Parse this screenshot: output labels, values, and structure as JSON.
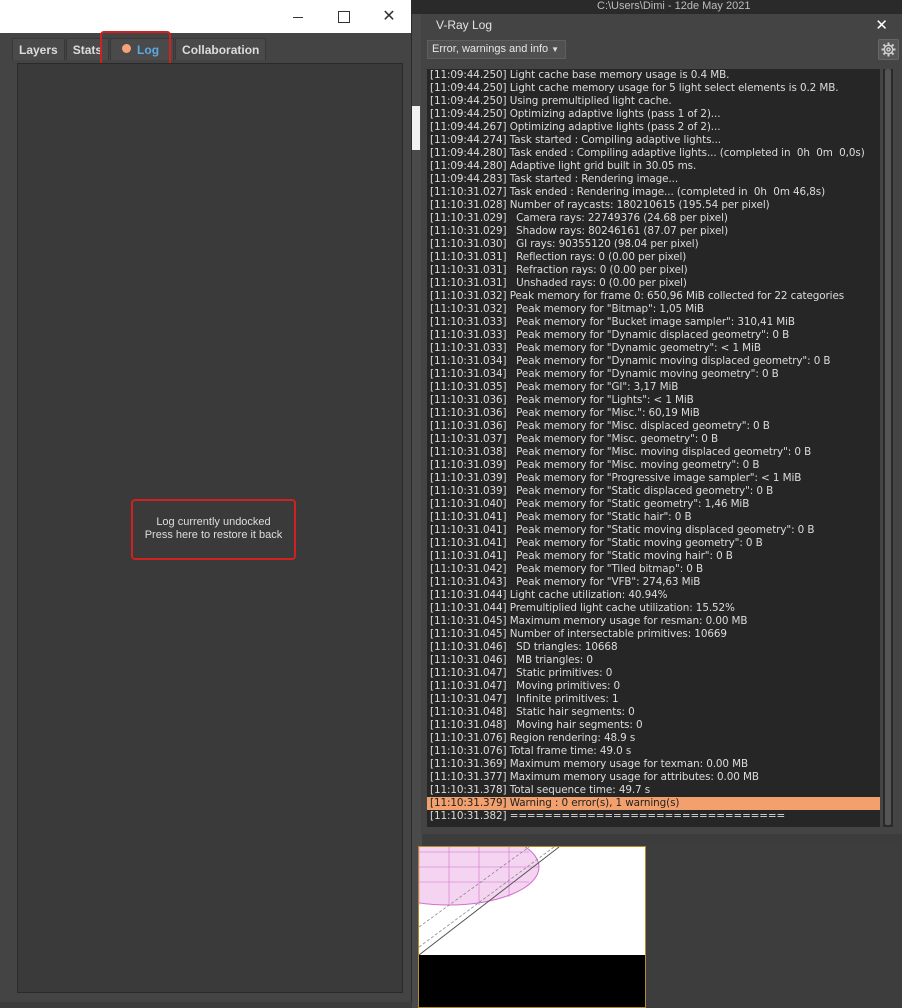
{
  "background": {
    "top_strip_text": "C:\\Users\\Dimi - 12de May 2021"
  },
  "left_window": {
    "window_controls": {
      "minimize": "",
      "maximize": "",
      "close": "✕"
    },
    "tabs": [
      {
        "label": "Layers",
        "active": false
      },
      {
        "label": "Stats",
        "active": false
      },
      {
        "label": "Log",
        "active": true
      },
      {
        "label": "Collaboration",
        "active": false
      }
    ],
    "undocked_message": {
      "line1": "Log currently undocked",
      "line2": "Press here to restore it back"
    }
  },
  "vray_log": {
    "title": "V-Ray Log",
    "close": "✕",
    "filter": {
      "selected": "Error, warnings and info"
    },
    "lines": [
      "[11:09:44.250] Light cache base memory usage is 0.4 MB.",
      "[11:09:44.250] Light cache memory usage for 5 light select elements is 0.2 MB.",
      "[11:09:44.250] Using premultiplied light cache.",
      "[11:09:44.250] Optimizing adaptive lights (pass 1 of 2)...",
      "[11:09:44.267] Optimizing adaptive lights (pass 2 of 2)...",
      "[11:09:44.274] Task started : Compiling adaptive lights...",
      "[11:09:44.280] Task ended : Compiling adaptive lights... (completed in  0h  0m  0,0s)",
      "[11:09:44.280] Adaptive light grid built in 30.05 ms.",
      "[11:09:44.283] Task started : Rendering image...",
      "[11:10:31.027] Task ended : Rendering image... (completed in  0h  0m 46,8s)",
      "[11:10:31.028] Number of raycasts: 180210615 (195.54 per pixel)",
      "[11:10:31.029]   Camera rays: 22749376 (24.68 per pixel)",
      "[11:10:31.029]   Shadow rays: 80246161 (87.07 per pixel)",
      "[11:10:31.030]   GI rays: 90355120 (98.04 per pixel)",
      "[11:10:31.031]   Reflection rays: 0 (0.00 per pixel)",
      "[11:10:31.031]   Refraction rays: 0 (0.00 per pixel)",
      "[11:10:31.031]   Unshaded rays: 0 (0.00 per pixel)",
      "[11:10:31.032] Peak memory for frame 0: 650,96 MiB collected for 22 categories",
      "[11:10:31.032]   Peak memory for \"Bitmap\": 1,05 MiB",
      "[11:10:31.033]   Peak memory for \"Bucket image sampler\": 310,41 MiB",
      "[11:10:31.033]   Peak memory for \"Dynamic displaced geometry\": 0 B",
      "[11:10:31.033]   Peak memory for \"Dynamic geometry\": < 1 MiB",
      "[11:10:31.034]   Peak memory for \"Dynamic moving displaced geometry\": 0 B",
      "[11:10:31.034]   Peak memory for \"Dynamic moving geometry\": 0 B",
      "[11:10:31.035]   Peak memory for \"GI\": 3,17 MiB",
      "[11:10:31.036]   Peak memory for \"Lights\": < 1 MiB",
      "[11:10:31.036]   Peak memory for \"Misc.\": 60,19 MiB",
      "[11:10:31.036]   Peak memory for \"Misc. displaced geometry\": 0 B",
      "[11:10:31.037]   Peak memory for \"Misc. geometry\": 0 B",
      "[11:10:31.038]   Peak memory for \"Misc. moving displaced geometry\": 0 B",
      "[11:10:31.039]   Peak memory for \"Misc. moving geometry\": 0 B",
      "[11:10:31.039]   Peak memory for \"Progressive image sampler\": < 1 MiB",
      "[11:10:31.039]   Peak memory for \"Static displaced geometry\": 0 B",
      "[11:10:31.040]   Peak memory for \"Static geometry\": 1,46 MiB",
      "[11:10:31.041]   Peak memory for \"Static hair\": 0 B",
      "[11:10:31.041]   Peak memory for \"Static moving displaced geometry\": 0 B",
      "[11:10:31.041]   Peak memory for \"Static moving geometry\": 0 B",
      "[11:10:31.041]   Peak memory for \"Static moving hair\": 0 B",
      "[11:10:31.042]   Peak memory for \"Tiled bitmap\": 0 B",
      "[11:10:31.043]   Peak memory for \"VFB\": 274,63 MiB",
      "[11:10:31.044] Light cache utilization: 40.94%",
      "[11:10:31.044] Premultiplied light cache utilization: 15.52%",
      "[11:10:31.045] Maximum memory usage for resman: 0.00 MB",
      "[11:10:31.045] Number of intersectable primitives: 10669",
      "[11:10:31.046]   SD triangles: 10668",
      "[11:10:31.046]   MB triangles: 0",
      "[11:10:31.047]   Static primitives: 0",
      "[11:10:31.047]   Moving primitives: 0",
      "[11:10:31.047]   Infinite primitives: 1",
      "[11:10:31.048]   Static hair segments: 0",
      "[11:10:31.048]   Moving hair segments: 0",
      "[11:10:31.076] Region rendering: 48.9 s",
      "[11:10:31.076] Total frame time: 49.0 s",
      "[11:10:31.369] Maximum memory usage for texman: 0.00 MB",
      "[11:10:31.377] Maximum memory usage for attributes: 0.00 MB",
      "[11:10:31.378] Total sequence time: 49.7 s",
      "[11:10:31.379] Warning : 0 error(s), 1 warning(s)",
      "[11:10:31.382] ================================"
    ],
    "warning_line_index": 56,
    "colors": {
      "warning_bg": "#f2a06e",
      "tab_active": "#5aa9e6",
      "highlight": "#d02020"
    }
  }
}
